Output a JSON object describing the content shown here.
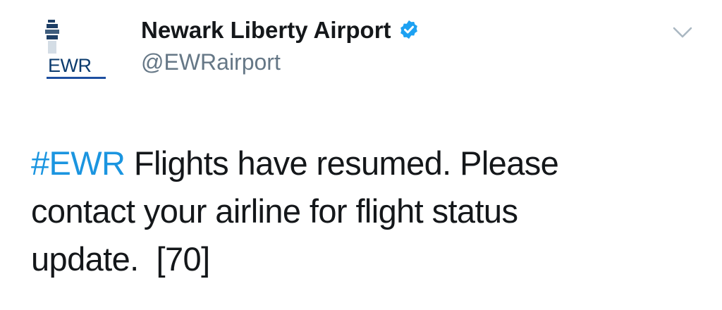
{
  "tweet": {
    "avatar": {
      "text": "EWR",
      "colors": {
        "tower": "#3f5d7d",
        "stripe": "#1e3f66",
        "text": "#0b3b6e",
        "underline": "#1e4fa0"
      }
    },
    "display_name": "Newark Liberty Airport",
    "verified": true,
    "verified_color": "#1da1f2",
    "handle": "@EWRairport",
    "menu_icon": "chevron-down-icon",
    "hashtag": "#EWR",
    "line1_rest": " Flights have resumed. Please",
    "line2": "contact your airline for flight status",
    "line3": "update.  [70]",
    "colors": {
      "text": "#14171a",
      "secondary": "#657786",
      "link": "#1b95e0",
      "caret": "#aab8c2"
    }
  }
}
